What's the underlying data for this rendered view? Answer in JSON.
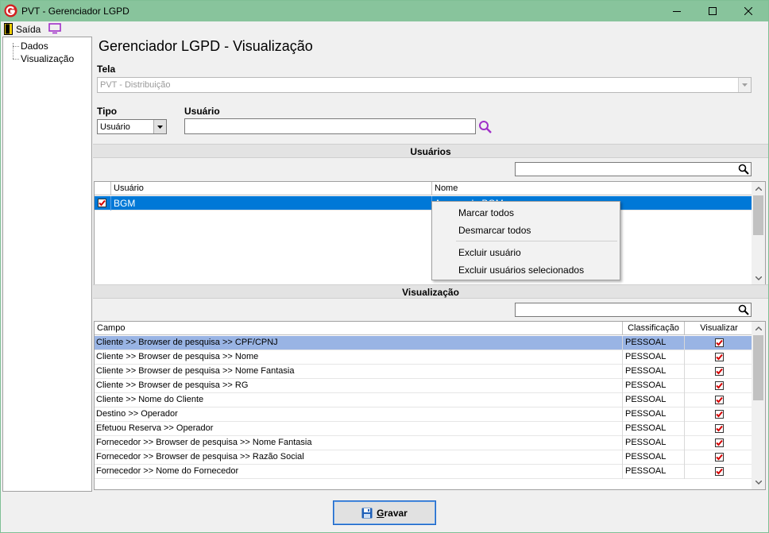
{
  "window": {
    "title": "PVT - Gerenciador LGPD"
  },
  "menu": {
    "exit_label": "Saída"
  },
  "tree": {
    "items": [
      "Dados",
      "Visualização"
    ]
  },
  "page": {
    "title": "Gerenciador LGPD - Visualização"
  },
  "form": {
    "tela_label": "Tela",
    "tela_value": "PVT - Distribuição",
    "tipo_label": "Tipo",
    "tipo_value": "Usuário",
    "usuario_label": "Usuário",
    "usuario_value": ""
  },
  "users_section": {
    "title": "Usuários",
    "search_value": "",
    "columns": [
      "Usuário",
      "Nome"
    ],
    "rows": [
      {
        "checked": true,
        "usuario": "BGM",
        "nome": "Acesso da BGM",
        "selected": true
      }
    ]
  },
  "context_menu": {
    "items": [
      "Marcar todos",
      "Desmarcar todos",
      "Excluir usuário",
      "Excluir usuários selecionados"
    ]
  },
  "view_section": {
    "title": "Visualização",
    "search_value": "",
    "columns": [
      "Campo",
      "Classificação",
      "Visualizar"
    ],
    "rows": [
      {
        "campo": "Cliente >> Browser de pesquisa >> CPF/CPNJ",
        "classificacao": "PESSOAL",
        "visualizar": true,
        "selected": true
      },
      {
        "campo": "Cliente >> Browser de pesquisa >> Nome",
        "classificacao": "PESSOAL",
        "visualizar": true
      },
      {
        "campo": "Cliente >> Browser de pesquisa >> Nome Fantasia",
        "classificacao": "PESSOAL",
        "visualizar": true
      },
      {
        "campo": "Cliente >> Browser de pesquisa >> RG",
        "classificacao": "PESSOAL",
        "visualizar": true
      },
      {
        "campo": "Cliente >> Nome do Cliente",
        "classificacao": "PESSOAL",
        "visualizar": true
      },
      {
        "campo": "Destino >> Operador",
        "classificacao": "PESSOAL",
        "visualizar": true
      },
      {
        "campo": "Efetuou Reserva >> Operador",
        "classificacao": "PESSOAL",
        "visualizar": true
      },
      {
        "campo": "Fornecedor >> Browser de pesquisa >> Nome Fantasia",
        "classificacao": "PESSOAL",
        "visualizar": true
      },
      {
        "campo": "Fornecedor >> Browser de pesquisa >> Razão Social",
        "classificacao": "PESSOAL",
        "visualizar": true
      },
      {
        "campo": "Fornecedor >> Nome do Fornecedor",
        "classificacao": "PESSOAL",
        "visualizar": true
      }
    ]
  },
  "actions": {
    "save_first": "G",
    "save_rest": "ravar"
  },
  "colors": {
    "titlebar": "#88c49c",
    "selection": "#0078d7",
    "selection_inactive": "#99b4e4",
    "check_red": "#d40000",
    "accent_purple": "#a030c8"
  }
}
